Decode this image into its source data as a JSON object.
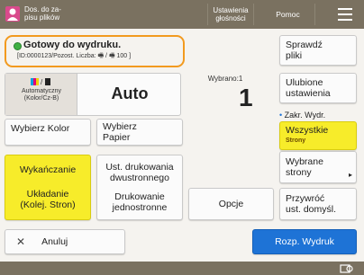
{
  "header": {
    "user_line1": "Dos. do za-",
    "user_line2": "pisu plików",
    "settings_line1": "Ustawienia",
    "settings_line2": "głośności",
    "help_label": "Pomoc"
  },
  "status": {
    "title": "Gotowy do wydruku.",
    "detail": "[ID:0000123/Pozost. Liczba: 🖷 / 🖷 100 ]"
  },
  "color_mode": {
    "sub_line1": "Automatyczny",
    "sub_line2": "(Kolor/Cz-B)",
    "value": "Auto"
  },
  "copies": {
    "label": "Wybrano:1",
    "value": "1"
  },
  "buttons": {
    "check_files": [
      "Sprawdź",
      "pliki"
    ],
    "favorites": [
      "Ulubione",
      "ustawienia"
    ],
    "range_label": "Zakr. Wydr.",
    "all_pages": "Wszystkie",
    "all_pages_sub": "Strony",
    "select_color": "Wybierz Kolor",
    "select_paper": [
      "Wybierz",
      "Papier"
    ],
    "finishing": "Wykańczanie",
    "finishing_sub": [
      "Układanie",
      "(Kolej. Stron)"
    ],
    "print_settings": [
      "Ust. drukowania",
      "dwustronnego"
    ],
    "print_settings_sub": [
      "Drukowanie",
      "jednostronne"
    ],
    "options": "Opcje",
    "selected_pages": "Wybrane strony",
    "restore_defaults": [
      "Przywróć",
      "ust. domyśl."
    ],
    "cancel": "Anuluj",
    "start_print": "Rozp. Wydruk"
  },
  "colors": {
    "topbar": "#7a7160",
    "highlight_yellow": "#f7ec2a",
    "status_outline": "#f29a1f",
    "start_blue": "#1e73d6"
  }
}
